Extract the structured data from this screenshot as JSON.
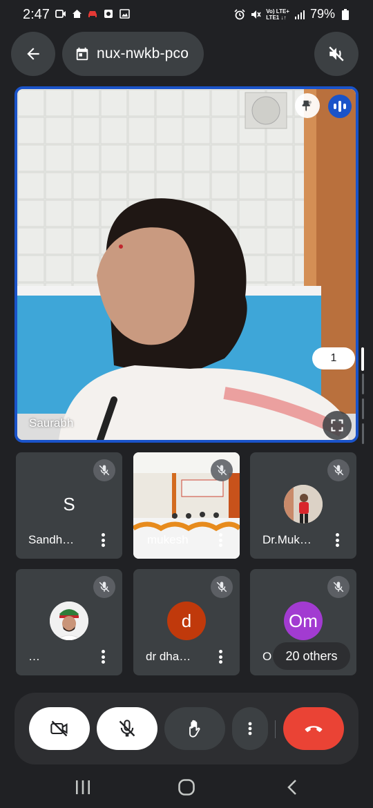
{
  "status_bar": {
    "time": "2:47",
    "net_top": "Vo) LTE+",
    "net_bottom": "LTE1 ↓↑",
    "battery": "79%"
  },
  "meeting": {
    "code": "nux-nwkb-pco"
  },
  "main_tile": {
    "name": "Saurabh"
  },
  "page_indicator": "1",
  "participants": [
    {
      "name": "Sandh…",
      "avatar_letter": "S",
      "avatar_color": "#4e9a2f"
    },
    {
      "name": "mukesh"
    },
    {
      "name": "Dr.Muk…"
    },
    {
      "name": "…"
    },
    {
      "name": "dr dha…",
      "avatar_letter": "d",
      "avatar_color": "#c0390b"
    },
    {
      "name": "O",
      "avatar_letter": "Om",
      "avatar_color": "#a23bd1"
    }
  ],
  "others_label": "20 others",
  "colors": {
    "background": "#202124",
    "tile": "#3c4043",
    "active_speaker_border": "#1a53c9",
    "end_call": "#ea4335"
  },
  "icons": {
    "back": "arrow-left-icon",
    "calendar": "calendar-icon",
    "speaker": "speaker-off-icon",
    "pin": "pin-icon",
    "speaking": "speaking-indicator-icon",
    "fullscreen": "fullscreen-icon",
    "video": "video-off-icon",
    "mic": "mic-off-icon",
    "hand": "raise-hand-icon",
    "more": "more-vert-icon",
    "end": "end-call-icon"
  }
}
